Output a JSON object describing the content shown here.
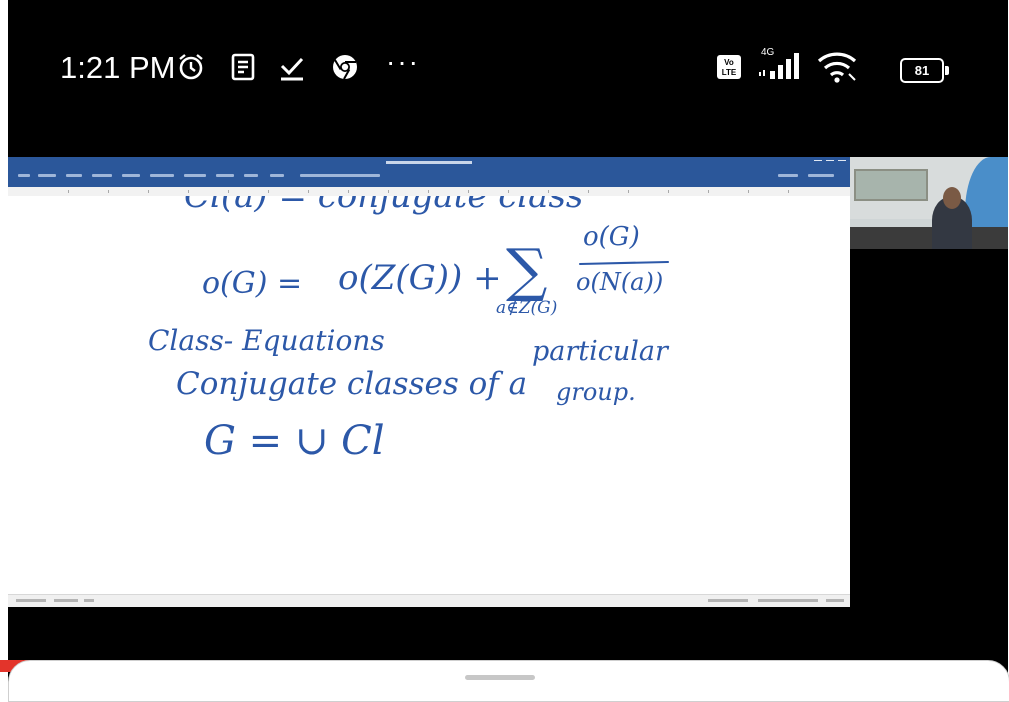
{
  "status_bar": {
    "time": "1:21 PM",
    "icons": [
      "alarm-clock-icon",
      "notes-icon",
      "download-done-icon",
      "chrome-icon",
      "more-dots-icon",
      "volte-icon",
      "signal-4g-icon",
      "wifi-icon",
      "battery-icon"
    ],
    "more": "···",
    "battery": "81",
    "network": "4G",
    "volte": "Vo LTE"
  },
  "whiteboard": {
    "line_top_partial": "Cl(a) = conjugate class",
    "formula": {
      "lhs": "o(G) =",
      "term1": "o(Z(G)) +",
      "sum_symbol": "∑",
      "sum_sub": "a∉Z(G)",
      "frac_num": "o(G)",
      "frac_den": "o(N(a))"
    },
    "heading": "Class- Equations",
    "sentence1": "Conjugate classes of a",
    "sentence_right": "particular",
    "sentence_right2": "group.",
    "union_line": "G = ∪ Cl"
  },
  "colors": {
    "ink": "#2c58a8",
    "word_ribbon": "#2b579a",
    "status_bg": "#000000"
  }
}
